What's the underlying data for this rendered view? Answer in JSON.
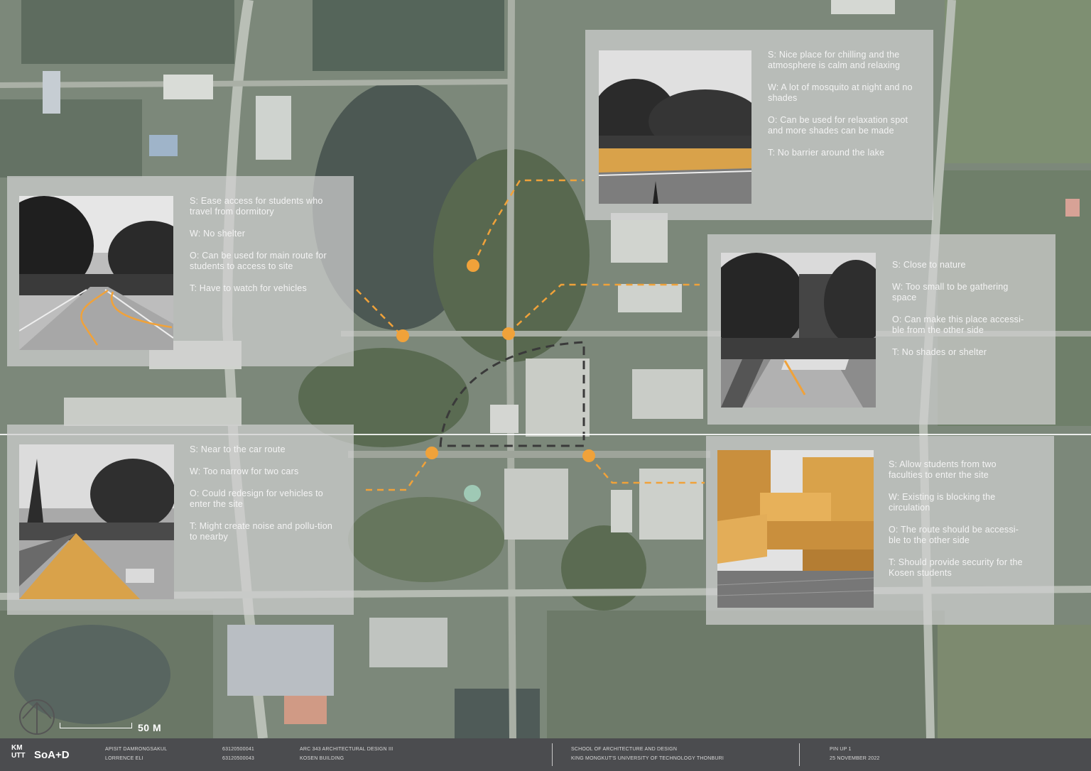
{
  "colors": {
    "accent": "#f0a23a",
    "route_dash": "#3a3a3a",
    "panel": "rgba(208,208,208,0.72)",
    "footer_bg": "#4b4c4f"
  },
  "panels": {
    "top_right": {
      "s": "S: Nice place for chilling and the atmosphere is calm and relaxing",
      "w": "W: A lot of mosquito at night and no shades",
      "o": "O: Can be used for relaxation spot and more shades can be made",
      "t": "T: No barrier around the lake"
    },
    "top_left": {
      "s": "S: Ease access for students who travel from dormitory",
      "w": "W: No shelter",
      "o": "O: Can be used for main route for students to access to site",
      "t": "T: Have to watch for vehicles"
    },
    "mid_right": {
      "s": "S: Close to nature",
      "w": "W: Too small to be gathering space",
      "o": "O: Can make this place accessi-ble from the other side",
      "t": "T: No shades or shelter"
    },
    "bottom_left": {
      "s": "S: Near to the car route",
      "w": "W: Too narrow for two cars",
      "o": "O: Could redesign for vehicles to enter the site",
      "t": "T: Might create noise and pollu-tion to nearby"
    },
    "bottom_right": {
      "s": "S: Allow students from two faculties to enter the site",
      "w": "W: Existing is blocking the circulation",
      "o": "O: The route should be accessi-ble to the other side",
      "t": "T: Should provide security for the Kosen students"
    }
  },
  "scale": {
    "label": "50 M"
  },
  "footer": {
    "logo_kmutt": "KM UTT",
    "logo_soad": "SoA+D",
    "names": [
      "APISIT DAMRONGSAKUL",
      "LORRENCE ELI"
    ],
    "ids": [
      "63120500041",
      "63120500043"
    ],
    "course": [
      "ARC 343 ARCHITECTURAL DESIGN III",
      "KOSEN BUILDING"
    ],
    "school": [
      "SCHOOL OF ARCHITECTURE AND DESIGN",
      "KING MONGKUT'S UNIVERSITY OF TECHNOLOGY THONBURI"
    ],
    "pinup": [
      "PIN UP 1",
      "25 NOVEMBER 2022"
    ]
  }
}
